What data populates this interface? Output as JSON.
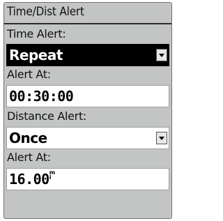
{
  "title": "Time/Dist Alert",
  "time_alert": {
    "label": "Time Alert:",
    "value": "Repeat"
  },
  "time_alert_at": {
    "label": "Alert At:",
    "value": "00:30:00"
  },
  "distance_alert": {
    "label": "Distance Alert:",
    "value": "Once"
  },
  "distance_alert_at": {
    "label": "Alert At:",
    "value": "16.00",
    "unit_top": "m",
    "unit_bottom": "i"
  },
  "icons": {
    "dropdown": "chevron-down-icon"
  }
}
